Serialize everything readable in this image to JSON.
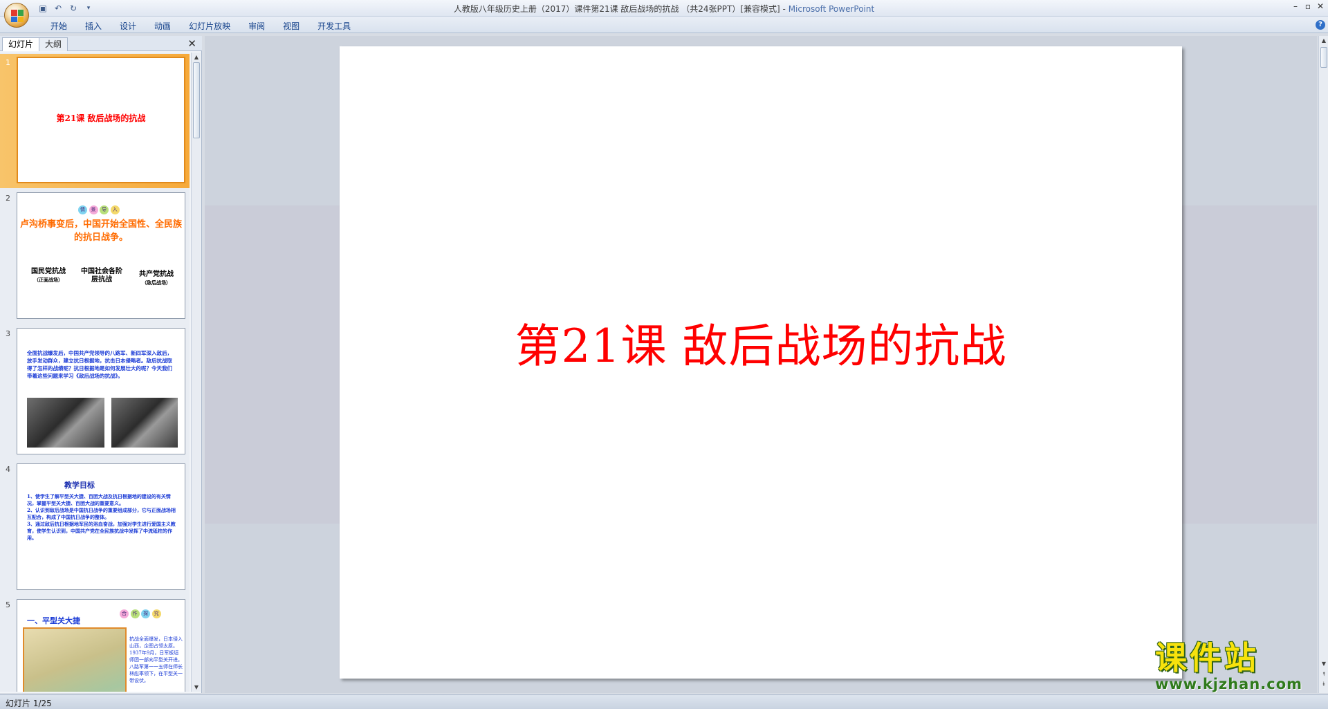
{
  "window": {
    "title": "人教版八年级历史上册（2017）课件第21课 敌后战场的抗战 （共24张PPT）[兼容模式]",
    "app_name": "Microsoft PowerPoint",
    "controls": [
      "–",
      "▫",
      "✕"
    ]
  },
  "ribbon": {
    "tabs": [
      "开始",
      "插入",
      "设计",
      "动画",
      "幻灯片放映",
      "审阅",
      "视图",
      "开发工具"
    ],
    "help_icon": "?"
  },
  "left_panel": {
    "tab_slides": "幻灯片",
    "tab_outline": "大纲",
    "close_icon": "✕"
  },
  "thumbnails": [
    {
      "num": "1",
      "title": "第21课 敌后战场的抗战"
    },
    {
      "num": "2",
      "badge": [
        "情",
        "景",
        "导",
        "入"
      ],
      "title": "卢沟桥事变后，中国开始全国性、全民族的抗日战争。",
      "col1": "国民党抗战",
      "col1_sub": "（正面战场）",
      "col2": "中国社会各阶层抗战",
      "col3": "共产党抗战",
      "col3_sub": "（敌后战场）"
    },
    {
      "num": "3",
      "text": "全面抗战爆发后，中国共产党领导的八路军、新四军深入敌后，放手发动群众，建立抗日根据地，抗击日本侵略者。敌后抗战取得了怎样的战绩呢？抗日根据地是如何发展壮大的呢？今天我们带着这些问题来学习《敌后战场的抗战》。"
    },
    {
      "num": "4",
      "heading": "教学目标",
      "goals": [
        "1、使学生了解平型关大捷、百团大战及抗日根据地的建设的有关情况，掌握平型关大捷、百团大战的重要意义。",
        "2、认识到敌后战场是中国抗日战争的重要组成部分，它与正面战场相互配合，构成了中国抗日战争的整体。",
        "3、通过敌后抗日根据地军民的浴血奋战，加强对学生进行爱国主义教育，使学生认识到，中国共产党在全民族抗战中发挥了中流砥柱的作用。"
      ]
    },
    {
      "num": "5",
      "heading": "一、平型关大捷",
      "badge": [
        "合",
        "作",
        "探",
        "究"
      ],
      "side": "抗战全面爆发，日本侵入山西，企图占领太原。1937年9月，日军板垣师团一部向平型关开进。八路军第一一五师在师长林彪率领下，在平型关一带设伏。"
    }
  ],
  "slide": {
    "title": "第21课 敌后战场的抗战"
  },
  "status": {
    "text": "幻灯片 1/25"
  },
  "watermark": {
    "main": "课件站",
    "url": "www.kjzhan.com"
  },
  "colors": {
    "accent_red": "#ff0000",
    "title_orange": "#ff6b00",
    "text_blue": "#1b3bd6",
    "selection_orange": "#f6a93a"
  }
}
